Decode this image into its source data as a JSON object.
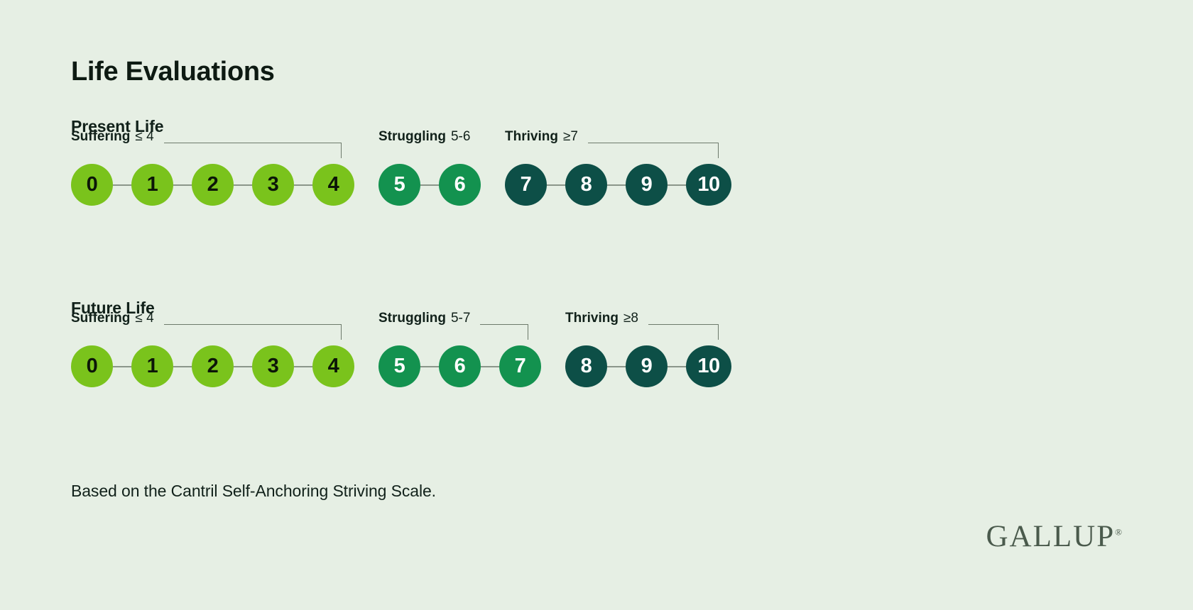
{
  "title": "Life Evaluations",
  "footnote": "Based on the Cantril Self-Anchoring Striving Scale.",
  "logo": {
    "text": "GALLUP",
    "registered": "®"
  },
  "colors": {
    "background": "#e6efe4",
    "suffering": "#7ac31c",
    "struggling": "#13924f",
    "thriving": "#0d4f47",
    "connector": "#8b968a",
    "bracket": "#6d7a6b",
    "text": "#11211a",
    "logo": "#4a5a4c"
  },
  "chart_data": {
    "type": "diagram",
    "title": "Life Evaluations",
    "subtitle": "",
    "note": "Based on the Cantril Self-Anchoring Striving Scale.",
    "scale_min": 0,
    "scale_max": 10,
    "sections": [
      {
        "heading": "Present Life",
        "groups": [
          {
            "category": "Suffering",
            "range": "≤ 4",
            "values": [
              "0",
              "1",
              "2",
              "3",
              "4"
            ],
            "color_key": "suffering",
            "has_bracket": true
          },
          {
            "category": "Struggling",
            "range": "5-6",
            "values": [
              "5",
              "6"
            ],
            "color_key": "struggling",
            "has_bracket": false
          },
          {
            "category": "Thriving",
            "range": "≥7",
            "values": [
              "7",
              "8",
              "9",
              "10"
            ],
            "color_key": "thriving",
            "has_bracket": true
          }
        ]
      },
      {
        "heading": "Future Life",
        "groups": [
          {
            "category": "Suffering",
            "range": "≤ 4",
            "values": [
              "0",
              "1",
              "2",
              "3",
              "4"
            ],
            "color_key": "suffering",
            "has_bracket": true
          },
          {
            "category": "Struggling",
            "range": "5-7",
            "values": [
              "5",
              "6",
              "7"
            ],
            "color_key": "struggling",
            "has_bracket": true
          },
          {
            "category": "Thriving",
            "range": "≥8",
            "values": [
              "8",
              "9",
              "10"
            ],
            "color_key": "thriving",
            "has_bracket": true
          }
        ]
      }
    ]
  }
}
